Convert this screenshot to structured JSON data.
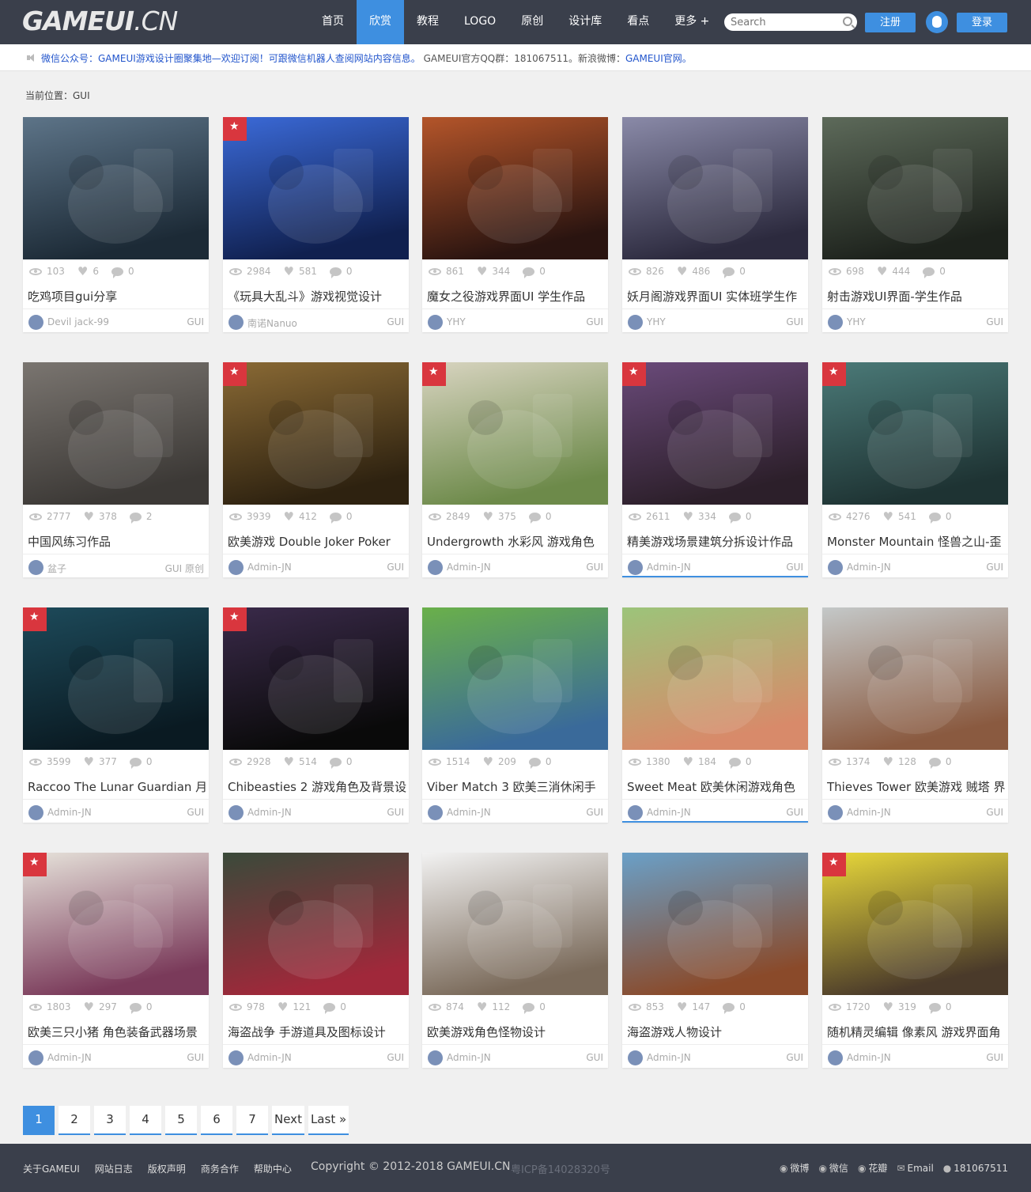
{
  "header": {
    "logo_bold": "GAMEUI",
    "logo_light": ".CN",
    "nav": [
      "首页",
      "欣赏",
      "教程",
      "LOGO",
      "原创",
      "设计库",
      "看点",
      "更多 +"
    ],
    "active_nav": 1,
    "search_placeholder": "Search",
    "register_label": "注册",
    "login_label": "登录"
  },
  "notice": {
    "text_blue": "微信公众号：GAMEUI游戏设计圈聚集地—欢迎订阅！可跟微信机器人查阅网站内容信息。",
    "text_gray": " GAMEUI官方QQ群：181067511。新浪微博：",
    "text_blue2": "GAMEUI官网。"
  },
  "breadcrumb": "当前位置：GUI",
  "cards": [
    {
      "views": "103",
      "likes": "6",
      "comments": "0",
      "title": "吃鸡项目gui分享",
      "author": "Devil jack-99",
      "cat": "GUI",
      "star": false,
      "hl": false,
      "colors": [
        "#5d7488",
        "#1c2a36"
      ]
    },
    {
      "views": "2984",
      "likes": "581",
      "comments": "0",
      "title": "《玩具大乱斗》游戏视觉设计",
      "author": "南诺Nanuo",
      "cat": "GUI",
      "star": true,
      "hl": false,
      "colors": [
        "#3b6ad8",
        "#10204f"
      ]
    },
    {
      "views": "861",
      "likes": "344",
      "comments": "0",
      "title": "魔女之役游戏界面UI 学生作品",
      "author": "YHY",
      "cat": "GUI",
      "star": false,
      "hl": false,
      "colors": [
        "#b4552a",
        "#2a1410"
      ]
    },
    {
      "views": "826",
      "likes": "486",
      "comments": "0",
      "title": "妖月阁游戏界面UI 实体班学生作",
      "author": "YHY",
      "cat": "GUI",
      "star": false,
      "hl": false,
      "colors": [
        "#8a8aa8",
        "#2c2a3e"
      ]
    },
    {
      "views": "698",
      "likes": "444",
      "comments": "0",
      "title": "射击游戏UI界面-学生作品",
      "author": "YHY",
      "cat": "GUI",
      "star": false,
      "hl": false,
      "colors": [
        "#5d6a5a",
        "#1d221c"
      ]
    },
    {
      "views": "2777",
      "likes": "378",
      "comments": "2",
      "title": "中国风练习作品",
      "author": "盆子",
      "cat": "GUI 原创",
      "star": false,
      "hl": false,
      "colors": [
        "#7a7570",
        "#3c3936"
      ]
    },
    {
      "views": "3939",
      "likes": "412",
      "comments": "0",
      "title": "欧美游戏 Double Joker Poker",
      "author": "Admin-JN",
      "cat": "GUI",
      "star": true,
      "hl": false,
      "colors": [
        "#8a6a35",
        "#2e2210"
      ]
    },
    {
      "views": "2849",
      "likes": "375",
      "comments": "0",
      "title": "Undergrowth 水彩风 游戏角色",
      "author": "Admin-JN",
      "cat": "GUI",
      "star": true,
      "hl": false,
      "colors": [
        "#d8d4c0",
        "#6d8a4a"
      ]
    },
    {
      "views": "2611",
      "likes": "334",
      "comments": "0",
      "title": "精美游戏场景建筑分拆设计作品",
      "author": "Admin-JN",
      "cat": "GUI",
      "star": true,
      "hl": true,
      "colors": [
        "#6a4a7a",
        "#2c1f2a"
      ]
    },
    {
      "views": "4276",
      "likes": "541",
      "comments": "0",
      "title": "Monster Mountain 怪兽之山-歪",
      "author": "Admin-JN",
      "cat": "GUI",
      "star": true,
      "hl": false,
      "colors": [
        "#4b7a78",
        "#1e3333"
      ]
    },
    {
      "views": "3599",
      "likes": "377",
      "comments": "0",
      "title": "Raccoo The Lunar Guardian 月",
      "author": "Admin-JN",
      "cat": "GUI",
      "star": true,
      "hl": false,
      "colors": [
        "#1d4a5a",
        "#0a1a22"
      ]
    },
    {
      "views": "2928",
      "likes": "514",
      "comments": "0",
      "title": "Chibeasties 2 游戏角色及背景设",
      "author": "Admin-JN",
      "cat": "GUI",
      "star": true,
      "hl": false,
      "colors": [
        "#3a2a4a",
        "#0a0a0a"
      ]
    },
    {
      "views": "1514",
      "likes": "209",
      "comments": "0",
      "title": "Viber Match 3 欧美三消休闲手",
      "author": "Admin-JN",
      "cat": "GUI",
      "star": false,
      "hl": false,
      "colors": [
        "#6ab04a",
        "#3a6a9a"
      ]
    },
    {
      "views": "1380",
      "likes": "184",
      "comments": "0",
      "title": "Sweet Meat 欧美休闲游戏角色",
      "author": "Admin-JN",
      "cat": "GUI",
      "star": false,
      "hl": true,
      "colors": [
        "#9cc47a",
        "#d88a6a"
      ]
    },
    {
      "views": "1374",
      "likes": "128",
      "comments": "0",
      "title": "Thieves Tower 欧美游戏 贼塔 界",
      "author": "Admin-JN",
      "cat": "GUI",
      "star": false,
      "hl": false,
      "colors": [
        "#c4c8c8",
        "#8a5a40"
      ]
    },
    {
      "views": "1803",
      "likes": "297",
      "comments": "0",
      "title": "欧美三只小猪 角色装备武器场景",
      "author": "Admin-JN",
      "cat": "GUI",
      "star": true,
      "hl": false,
      "colors": [
        "#e6e2da",
        "#7a3a5a"
      ]
    },
    {
      "views": "978",
      "likes": "121",
      "comments": "0",
      "title": "海盗战争 手游道具及图标设计",
      "author": "Admin-JN",
      "cat": "GUI",
      "star": false,
      "hl": false,
      "colors": [
        "#3a4a3a",
        "#a0283a"
      ]
    },
    {
      "views": "874",
      "likes": "112",
      "comments": "0",
      "title": "欧美游戏角色怪物设计",
      "author": "Admin-JN",
      "cat": "GUI",
      "star": false,
      "hl": false,
      "colors": [
        "#f2f2f2",
        "#7a6a5a"
      ]
    },
    {
      "views": "853",
      "likes": "147",
      "comments": "0",
      "title": "海盗游戏人物设计",
      "author": "Admin-JN",
      "cat": "GUI",
      "star": false,
      "hl": false,
      "colors": [
        "#6aa0c8",
        "#8a4a2a"
      ]
    },
    {
      "views": "1720",
      "likes": "319",
      "comments": "0",
      "title": "随机精灵编辑 像素风 游戏界面角",
      "author": "Admin-JN",
      "cat": "GUI",
      "star": true,
      "hl": false,
      "colors": [
        "#e8d83a",
        "#4a3a2a"
      ]
    }
  ],
  "pagination": [
    "1",
    "2",
    "3",
    "4",
    "5",
    "6",
    "7",
    "Next",
    "Last »"
  ],
  "current_page": "1",
  "footer": {
    "links": [
      "关于GAMEUI",
      "网站日志",
      "版权声明",
      "商务合作",
      "帮助中心"
    ],
    "copyright": "Copyright © 2012-2018 GAMEUI.CN",
    "icp": "粤ICP备14028320号",
    "social": [
      "微博",
      "微信",
      "花瓣",
      "Email",
      "181067511"
    ]
  },
  "colors": {
    "accent": "#3e8fe0",
    "header_bg": "#3a3f4b",
    "star_red": "#d9363e"
  }
}
